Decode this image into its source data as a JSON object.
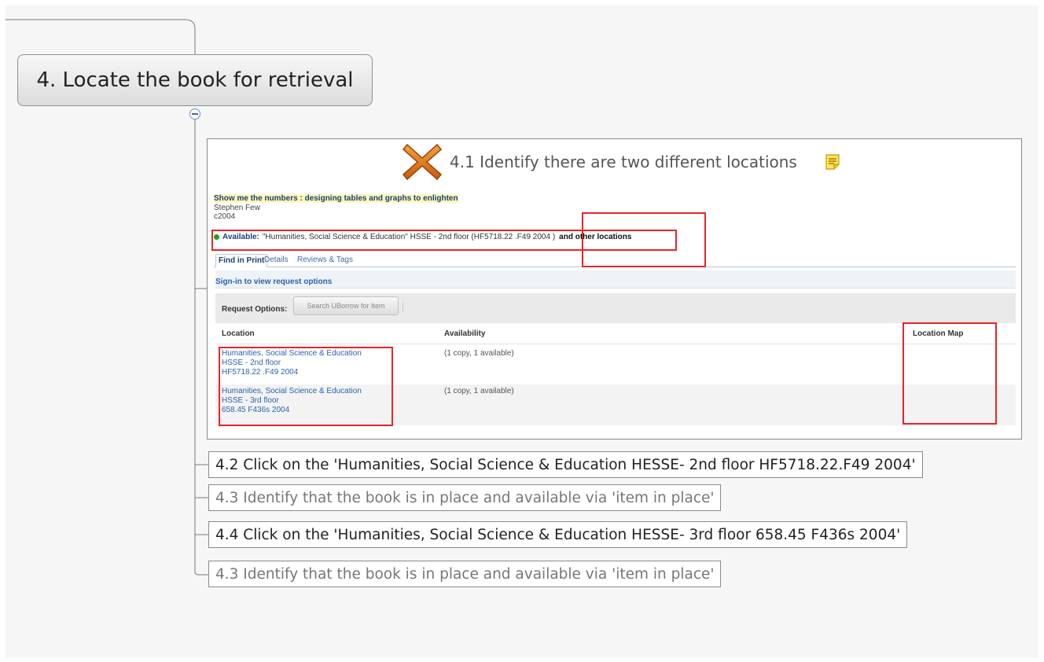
{
  "central_topic": {
    "label": "4. Locate the book for retrieval"
  },
  "image_topic": {
    "label": "4.1 Identify there are two different locations",
    "marker_icon": "red-cross-icon",
    "note_icon": "note-icon",
    "catalog": {
      "book_title": "Show me the numbers : designing tables and graphs to enlighten",
      "author": "Stephen Few",
      "date": "c2004",
      "availability": {
        "label": "Available:",
        "text": "\"Humanities, Social Science & Education\" HSSE - 2nd floor (HF5718.22 .F49 2004 )",
        "other": "and other locations"
      },
      "tabs": [
        "Find in Print",
        "Details",
        "Reviews & Tags"
      ],
      "signin": "Sign-in to view request options",
      "request_label": "Request Options:",
      "request_button": "Search UBorrow for Item",
      "columns": [
        "Location",
        "Availability",
        "Location Map"
      ],
      "rows": [
        {
          "loc1": "Humanities, Social Science & Education",
          "loc2": "HSSE - 2nd floor",
          "loc3": "HF5718.22 .F49 2004",
          "availability": "(1 copy, 1 available)"
        },
        {
          "loc1": "Humanities, Social Science & Education",
          "loc2": "HSSE - 3rd floor",
          "loc3": "658.45 F436s 2004",
          "availability": "(1 copy, 1 available)"
        }
      ]
    }
  },
  "subtopics": [
    "4.2 Click on the 'Humanities, Social Science & Education HESSE- 2nd floor HF5718.22.F49 2004'",
    "4.3 Identify that the book is in place and available via 'item in place'",
    "4.4 Click on the 'Humanities, Social Science & Education HESSE- 3rd floor 658.45 F436s 2004'",
    "4.3 Identify that the book is in place and available via 'item in place'"
  ],
  "colors": {
    "highlight": "#e6252a",
    "link": "#2a62b0",
    "available_dot": "#1aa31a"
  }
}
